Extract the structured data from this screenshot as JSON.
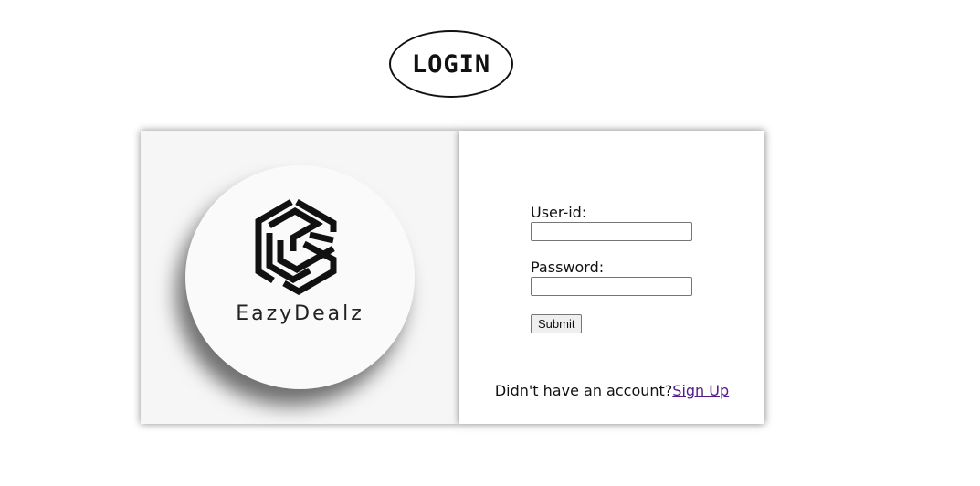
{
  "header": {
    "title": "LOGIN"
  },
  "brand": {
    "name": "EazyDealz",
    "logo_icon": "hexagon-logo-icon"
  },
  "form": {
    "user_label": "User-id:",
    "user_value": "",
    "password_label": "Password:",
    "password_value": "",
    "submit_label": "Submit"
  },
  "footer": {
    "prompt": "Didn't have an account?",
    "signup_label": "Sign Up"
  },
  "colors": {
    "link": "#551a8b",
    "text": "#111111",
    "panel_bg": "#f6f6f6"
  }
}
